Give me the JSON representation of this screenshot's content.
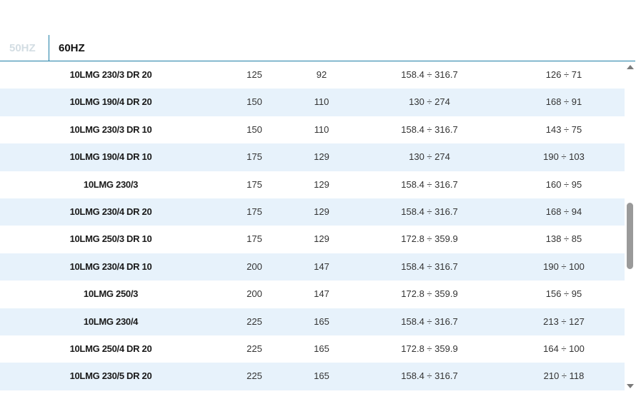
{
  "tabs": {
    "tab_50": "50HZ",
    "tab_60": "60HZ"
  },
  "rows": [
    [
      "10LMG 230/3 DR 20",
      "125",
      "92",
      "158.4 ÷ 316.7",
      "126 ÷ 71"
    ],
    [
      "10LMG 190/4 DR 20",
      "150",
      "110",
      "130 ÷ 274",
      "168 ÷ 91"
    ],
    [
      "10LMG 230/3 DR 10",
      "150",
      "110",
      "158.4 ÷ 316.7",
      "143 ÷ 75"
    ],
    [
      "10LMG 190/4 DR 10",
      "175",
      "129",
      "130 ÷ 274",
      "190 ÷ 103"
    ],
    [
      "10LMG 230/3",
      "175",
      "129",
      "158.4 ÷ 316.7",
      "160 ÷ 95"
    ],
    [
      "10LMG 230/4 DR 20",
      "175",
      "129",
      "158.4 ÷ 316.7",
      "168 ÷ 94"
    ],
    [
      "10LMG 250/3 DR 10",
      "175",
      "129",
      "172.8 ÷ 359.9",
      "138 ÷ 85"
    ],
    [
      "10LMG 230/4 DR 10",
      "200",
      "147",
      "158.4 ÷ 316.7",
      "190 ÷ 100"
    ],
    [
      "10LMG 250/3",
      "200",
      "147",
      "172.8 ÷ 359.9",
      "156 ÷ 95"
    ],
    [
      "10LMG 230/4",
      "225",
      "165",
      "158.4 ÷ 316.7",
      "213 ÷ 127"
    ],
    [
      "10LMG 250/4 DR 20",
      "225",
      "165",
      "172.8 ÷ 359.9",
      "164 ÷ 100"
    ],
    [
      "10LMG 230/5 DR 20",
      "225",
      "165",
      "158.4 ÷ 316.7",
      "210 ÷ 118"
    ]
  ],
  "scrollbar": {
    "up_icon": "triangle-up-icon",
    "down_icon": "triangle-down-icon",
    "scroll_position": 0.42
  }
}
